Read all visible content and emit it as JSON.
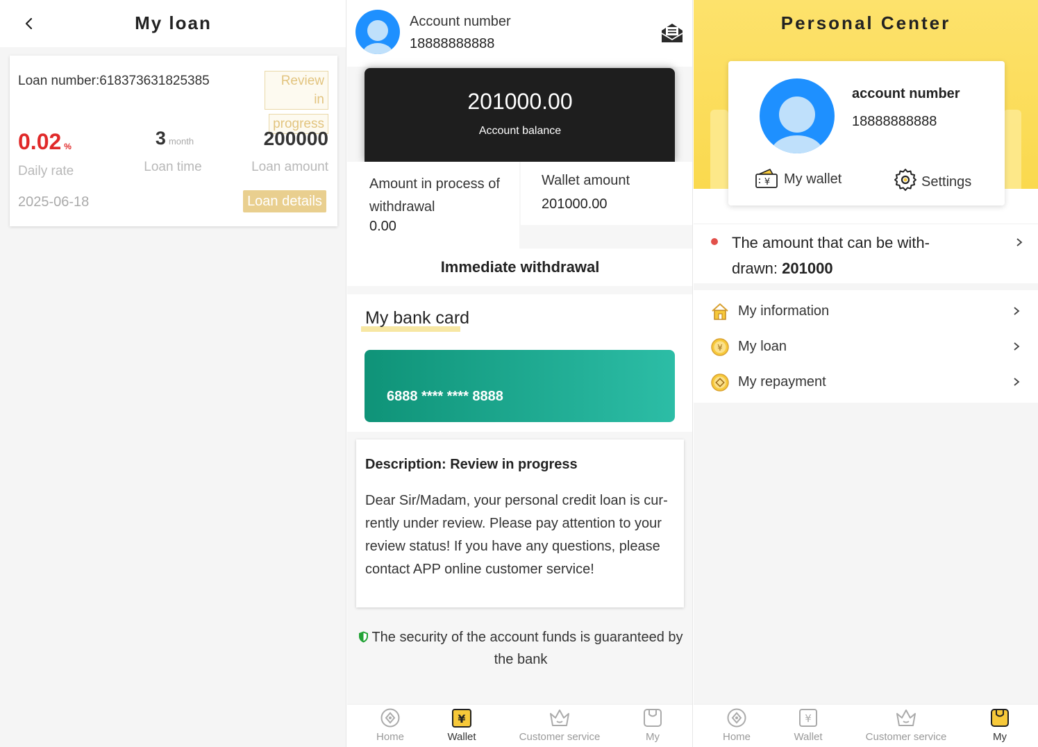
{
  "my_loan": {
    "title": "My loan",
    "loan_number_label": "Loan number:",
    "loan_number": "618373631825385",
    "status_line1": "Review in",
    "status_line2": "progress",
    "daily_rate_value": "0.02",
    "daily_rate_unit": "%",
    "daily_rate_label": "Daily rate",
    "loan_time_value": "3",
    "loan_time_unit": "month",
    "loan_time_label": "Loan time",
    "loan_amount_value": "200000",
    "loan_amount_label": "Loan amount",
    "date": "2025-06-18",
    "details_button": "Loan details"
  },
  "wallet": {
    "account_label": "Account number",
    "account_number": "18888888888",
    "balance_value": "201000.00",
    "balance_label": "Account balance",
    "processing_label": "Amount in process of withdrawal",
    "processing_value": "0.00",
    "wallet_amount_label": "Wallet amount",
    "wallet_amount_value": "201000.00",
    "withdraw_button": "Immediate withdrawal",
    "bank_card_title": "My bank card",
    "card_number": "6888 **** **** 8888",
    "description_title": "Description:  Review in progress",
    "description_body": "Dear Sir/Madam, your personal credit loan is cur-rently under review. Please pay attention to your review status! If you have any questions, please contact APP online customer service!",
    "security_note": "The security of the account funds is guaranteed by the bank"
  },
  "personal_center": {
    "title": "Personal Center",
    "account_label": "account number",
    "account_number": "18888888888",
    "wallet_label": "My wallet",
    "settings_label": "Settings",
    "withdrawable_label": "The amount that can be with-drawn: ",
    "withdrawable_value": "201000",
    "menu": [
      {
        "label": "My information",
        "icon": "house-icon"
      },
      {
        "label": "My loan",
        "icon": "yuan-coin-icon"
      },
      {
        "label": "My repayment",
        "icon": "repayment-coin-icon"
      }
    ]
  },
  "tabbar": {
    "home": "Home",
    "wallet": "Wallet",
    "customer_service": "Customer service",
    "my": "My"
  },
  "colors": {
    "accent_gold": "#e9cf8f",
    "rate_red": "#e02929",
    "header_yellow": "#fad94e",
    "card_teal": "#1aa88e",
    "avatar_blue": "#1e90ff"
  }
}
